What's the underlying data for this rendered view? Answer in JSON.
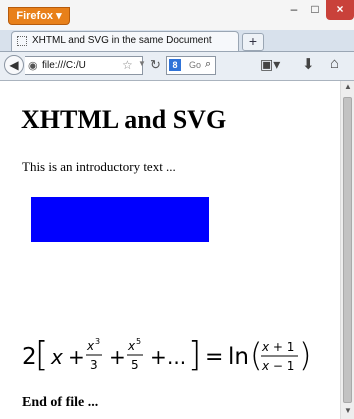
{
  "browser": {
    "menu_button_label": "Firefox ▾",
    "window_controls": {
      "minimize": "–",
      "maximize": "□",
      "close": "×"
    },
    "tab": {
      "title": "XHTML and SVG in the same Document"
    },
    "new_tab_label": "+",
    "url": "file:///C:/U",
    "search": {
      "engine_glyph": "8",
      "placeholder": "Go"
    },
    "icons": {
      "back": "back-arrow-icon",
      "globe": "globe-icon",
      "star": "bookmark-star-icon",
      "reload": "reload-icon",
      "search": "search-icon",
      "bookmarks": "bookmarks-menu-icon",
      "download": "download-icon",
      "home": "home-icon"
    }
  },
  "page": {
    "heading": "XHTML and SVG",
    "intro": "This is an introductory text ...",
    "rect_color": "#0000ff",
    "formula": "2[x + x³/3 + x⁵/5 + ...] = ln((x+1)/(x−1))",
    "footer": "End of file ..."
  }
}
